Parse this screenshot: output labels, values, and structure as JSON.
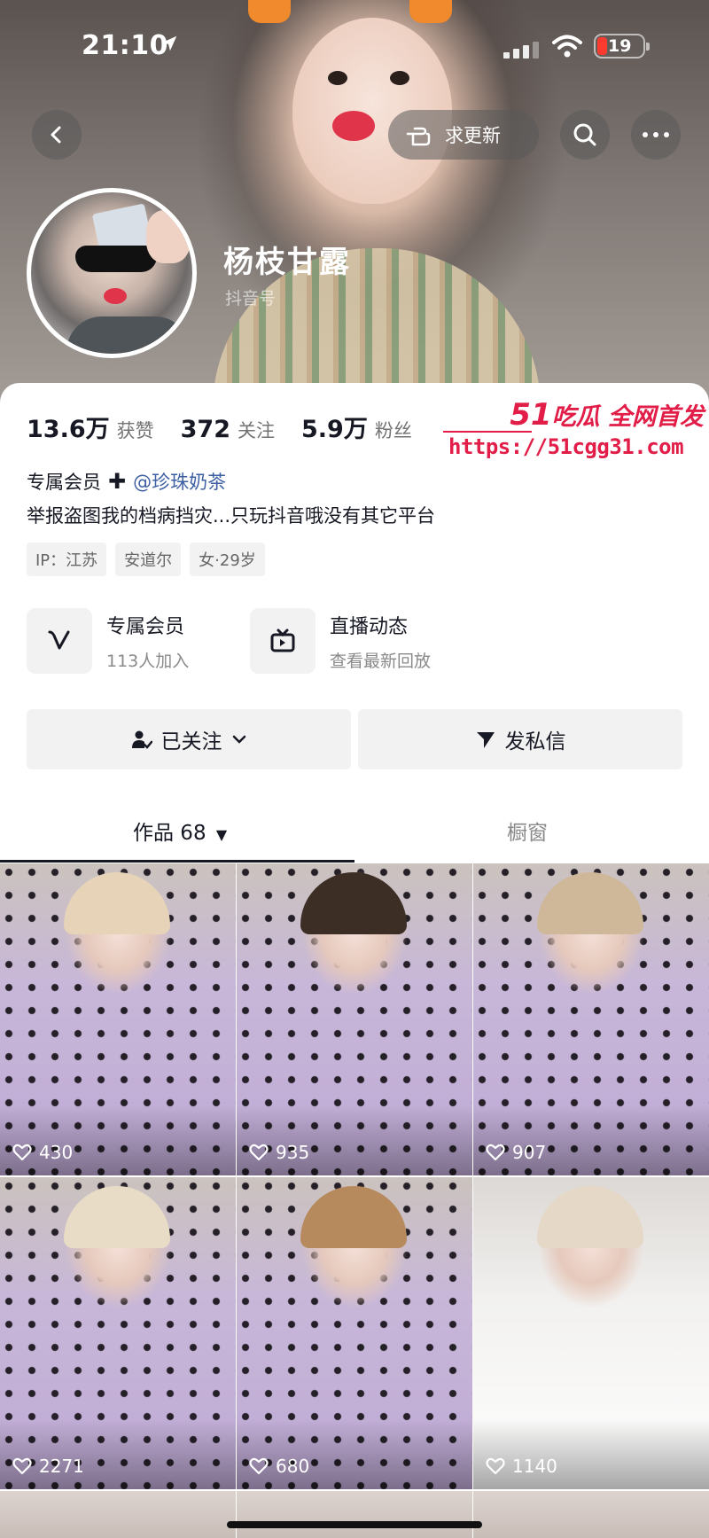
{
  "status_bar": {
    "time": "21:10",
    "battery": "19"
  },
  "header": {
    "update_button": "求更新"
  },
  "profile": {
    "name": "杨枝甘露",
    "id_label": "抖音号",
    "stats": [
      {
        "value": "13.6万",
        "label": "获赞"
      },
      {
        "value": "372",
        "label": "关注"
      },
      {
        "value": "5.9万",
        "label": "粉丝"
      }
    ],
    "member_label": "专属会员",
    "member_link": "@珍珠奶茶",
    "bio": "举报盗图我的档病挡灾...只玩抖音哦没有其它平台",
    "tags": [
      "IP：江苏",
      "安道尔",
      "女·29岁"
    ]
  },
  "features": [
    {
      "title": "专属会员",
      "subtitle": "113人加入",
      "icon": "v-icon"
    },
    {
      "title": "直播动态",
      "subtitle": "查看最新回放",
      "icon": "tv-icon"
    }
  ],
  "actions": {
    "follow": "已关注",
    "message": "发私信"
  },
  "tabs": {
    "works": "作品 68",
    "shop": "橱窗"
  },
  "videos": [
    {
      "likes": "430"
    },
    {
      "likes": "935"
    },
    {
      "likes": "907"
    },
    {
      "likes": "2271"
    },
    {
      "likes": "680"
    },
    {
      "likes": "1140"
    }
  ],
  "watermark": {
    "brand_num": "51",
    "brand_text": "吃瓜 全网首发",
    "url": "https://51cgg31.com"
  },
  "colors": {
    "watermark": "#e11d48",
    "link": "#3c5ea2",
    "text": "#161823",
    "muted": "#737373"
  }
}
